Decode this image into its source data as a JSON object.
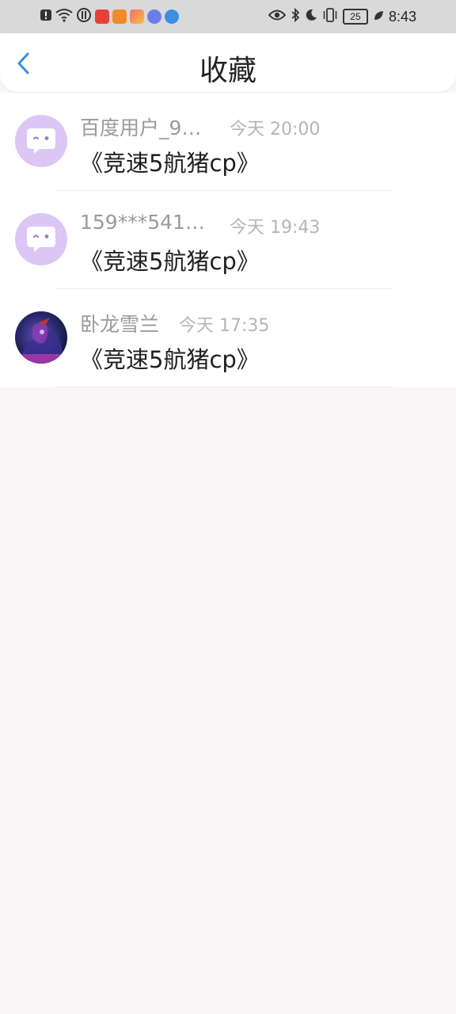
{
  "status_bar": {
    "time": "8:43",
    "battery": "25",
    "left_icons": [
      "alert-icon",
      "wifi-icon",
      "data-saver-icon",
      "huawei-app-icon",
      "video-app-icon",
      "store-app-icon",
      "music-app-icon",
      "browser-app-icon"
    ],
    "right_icons": [
      "eye-icon",
      "bluetooth-icon",
      "moon-icon",
      "vibrate-icon",
      "battery-icon",
      "leaf-icon"
    ]
  },
  "header": {
    "title": "收藏",
    "back_icon": "chevron-left-icon",
    "accent": "#3a8ee6"
  },
  "items": [
    {
      "name": "百度用户_9…",
      "time": "今天 20:00",
      "content": "《竞速5航猪cp》",
      "avatar": "default-chat-avatar"
    },
    {
      "name": "159***541…",
      "time": "今天 19:43",
      "content": "《竞速5航猪cp》",
      "avatar": "default-chat-avatar"
    },
    {
      "name": "卧龙雪兰",
      "time": "今天 17:35",
      "content": "《竞速5航猪cp》",
      "avatar": "photo-avatar"
    }
  ]
}
